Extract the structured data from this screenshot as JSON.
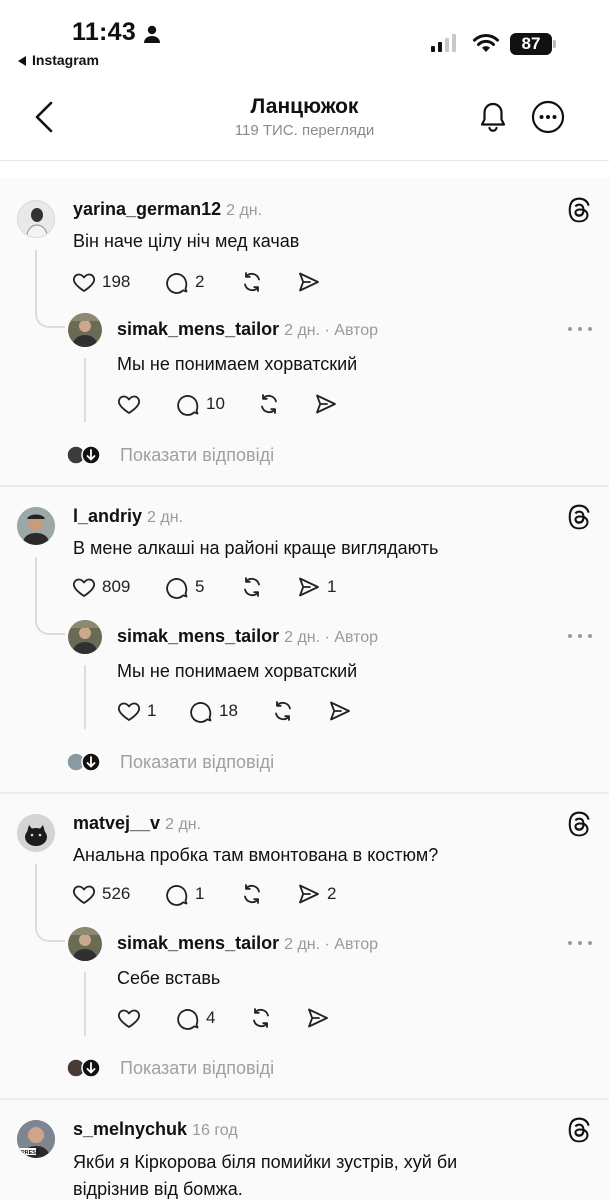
{
  "status_bar": {
    "time": "11:43",
    "back_app": "Instagram",
    "battery": "87"
  },
  "header": {
    "title": "Ланцюжок",
    "subtitle": "119 ТИС. перегляди"
  },
  "show_replies_label": "Показати відповіді",
  "threads": [
    {
      "username": "yarina_german12",
      "time": "2 дн.",
      "text": "Він наче цілу ніч мед качав",
      "likes": "198",
      "replies": "2",
      "shares": "",
      "reply": {
        "username": "simak_mens_tailor",
        "time": "2 дн. · Автор",
        "text": "Мы не понимаем хорватский",
        "likes": "",
        "replies": "10",
        "shares": ""
      }
    },
    {
      "username": "l_andriy",
      "time": "2 дн.",
      "text": "В мене алкаші на районі краще виглядають",
      "likes": "809",
      "replies": "5",
      "shares": "1",
      "reply": {
        "username": "simak_mens_tailor",
        "time": "2 дн. · Автор",
        "text": "Мы не понимаем хорватский",
        "likes": "1",
        "replies": "18",
        "shares": ""
      }
    },
    {
      "username": "matvej__v",
      "time": "2 дн.",
      "text": "Анальна пробка там вмонтована в костюм?",
      "likes": "526",
      "replies": "1",
      "shares": "2",
      "reply": {
        "username": "simak_mens_tailor",
        "time": "2 дн. · Автор",
        "text": "Себе вставь",
        "likes": "",
        "replies": "4",
        "shares": ""
      }
    },
    {
      "username": "s_melnychuk",
      "time": "16 год",
      "text_line1": "Якби я Кіркорова біля помийки зустрів, хуй би",
      "text_line2": "відрізнив від бомжа."
    }
  ]
}
